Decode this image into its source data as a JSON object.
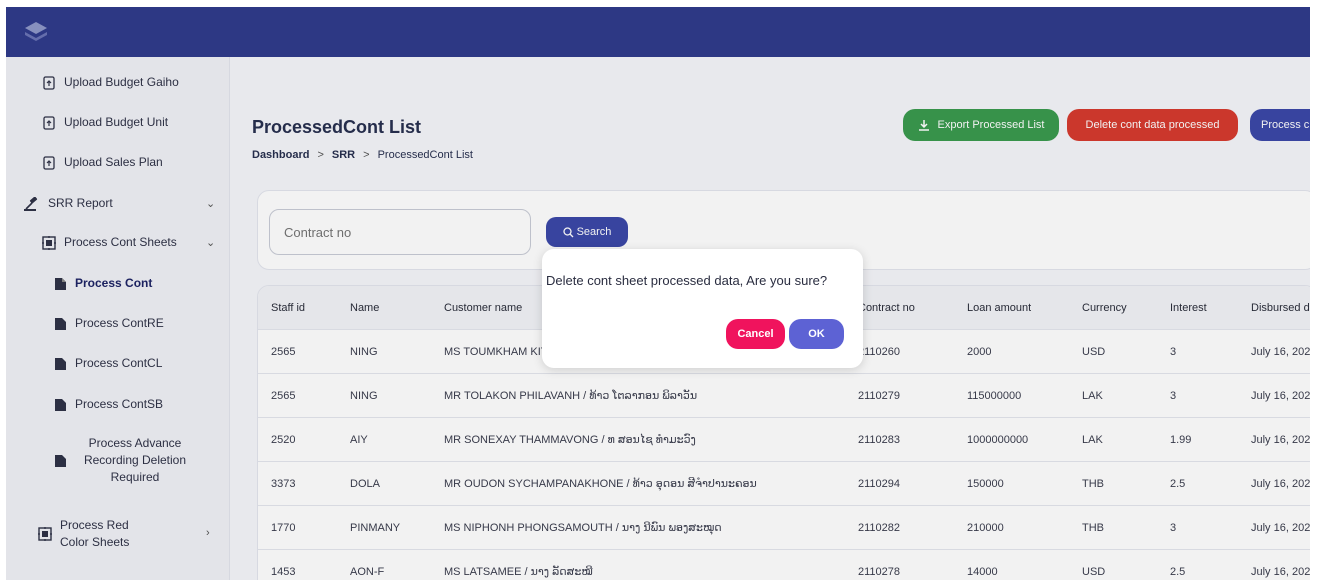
{
  "colors": {
    "topbar": "#303c8c",
    "export_button": "#3a9a4e",
    "delete_button": "#d63a2f",
    "primary_button": "#3b48a8",
    "cancel_button": "#f0135d",
    "ok_button": "#5d62d4"
  },
  "sidebar": {
    "upload_budget_gaiho": "Upload Budget Gaiho",
    "upload_budget_unit": "Upload Budget Unit",
    "upload_sales_plan": "Upload Sales Plan",
    "srr_report": "SRR Report",
    "process_cont_sheets": "Process Cont Sheets",
    "process_cont": "Process Cont",
    "process_contre": "Process ContRE",
    "process_contcl": "Process ContCL",
    "process_contsb": "Process ContSB",
    "process_advance": "Process Advance Recording Deletion Required",
    "process_red_color": "Process Red Color Sheets"
  },
  "header": {
    "title": "ProcessedCont List",
    "breadcrumb": [
      "Dashboard",
      "SRR",
      "ProcessedCont List"
    ],
    "export_label": "Export Processed List",
    "delete_label": "Delete cont data processed",
    "process_label": "Process c"
  },
  "search": {
    "placeholder": "Contract no",
    "button_label": "Search"
  },
  "table": {
    "columns": [
      "Staff id",
      "Name",
      "Customer name",
      "Contract no",
      "Loan amount",
      "Currency",
      "Interest",
      "Disbursed d"
    ],
    "rows": [
      [
        "2565",
        "NING",
        "MS TOUMKHAM KIT",
        "2110260",
        "2000",
        "USD",
        "3",
        "July 16, 202"
      ],
      [
        "2565",
        "NING",
        "MR TOLAKON PHILAVANH / ທ້າວ ໂຕລາກອນ ພິລາວັນ",
        "2110279",
        "115000000",
        "LAK",
        "3",
        "July 16, 202"
      ],
      [
        "2520",
        "AIY",
        "MR SONEXAY THAMMAVONG / ທ ສອນໄຊ ທຳມະວົງ",
        "2110283",
        "1000000000",
        "LAK",
        "1.99",
        "July 16, 202"
      ],
      [
        "3373",
        "DOLA",
        "MR OUDON SYCHAMPANAKHONE / ທ້າວ ອຸດອນ ສີຈຳປານະຄອນ",
        "2110294",
        "150000",
        "THB",
        "2.5",
        "July 16, 202"
      ],
      [
        "1770",
        "PINMANY",
        "MS NIPHONH PHONGSAMOUTH / ນາງ ນີພົນ ພອງສະໝຸດ",
        "2110282",
        "210000",
        "THB",
        "3",
        "July 16, 202"
      ],
      [
        "1453",
        "AON-F",
        "MS LATSAMEE / ນາງ ລັດສະໝີ",
        "2110278",
        "14000",
        "USD",
        "2.5",
        "July 16, 202"
      ]
    ]
  },
  "dialog": {
    "message": "Delete cont sheet processed data, Are you sure?",
    "cancel_label": "Cancel",
    "ok_label": "OK"
  }
}
